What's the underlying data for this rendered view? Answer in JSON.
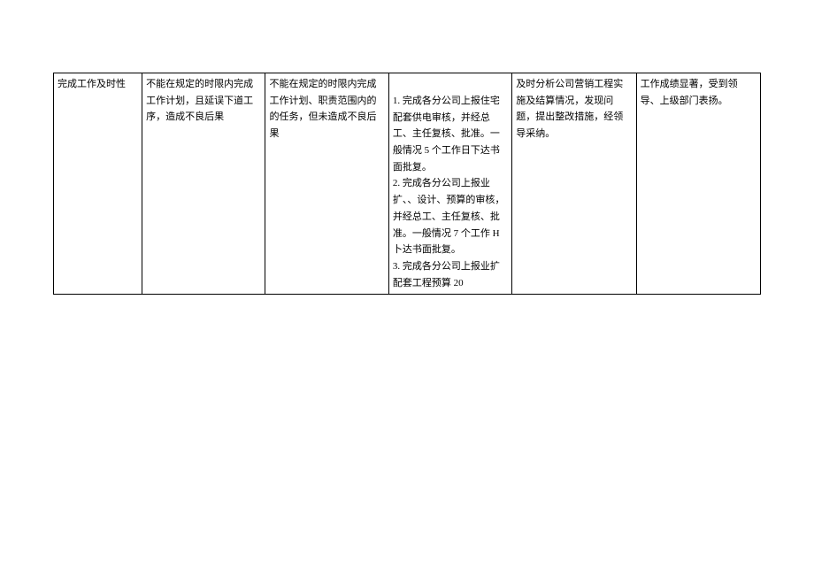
{
  "table": {
    "row": {
      "col1": "完成工作及时性",
      "col2": "不能在规定的时限内完成工作计划，且延误下道工序，造成不良后果",
      "col3": "不能在规定的时限内完成工作计划、职责范围内的的任务，但未造成不良后果",
      "col4": {
        "p1": "1. 完成各分公司上报住宅配套供电审核，并经总工、主任复核、批准。一般情况 5 个工作日下达书面批复。",
        "p2": "2. 完成各分公司上报业扩、、设计、预算的审核，并经总工、主任复核、批准。一般情况 7 个工作 H 卜达书面批复。",
        "p3": "3. 完成各分公司上报业扩配套工程预算 20"
      },
      "col5": "及时分析公司营销工程实施及结算情况，发现问题，提出整改措施，经领导采纳。",
      "col6": "工作成绩显著，受到领导、上级部门表扬。"
    }
  }
}
